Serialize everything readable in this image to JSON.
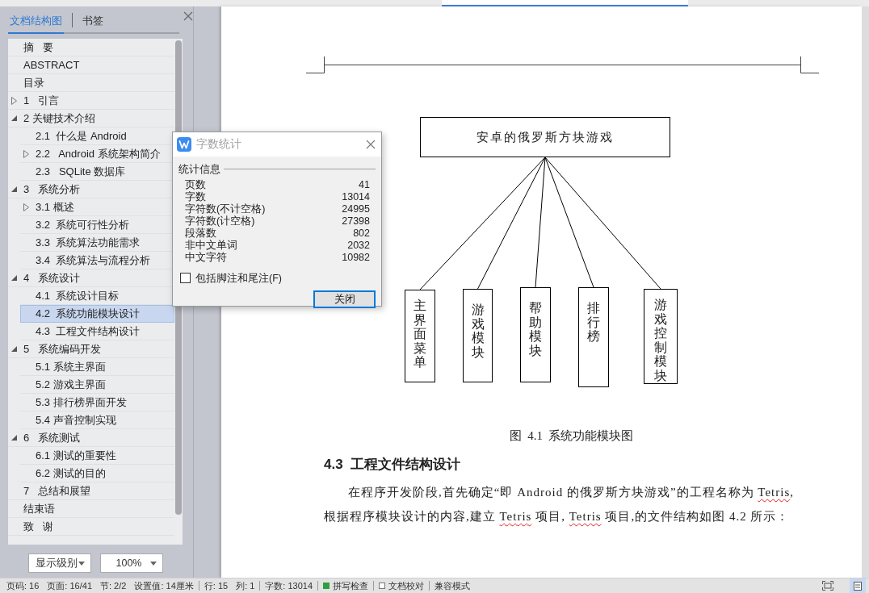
{
  "sidebar": {
    "tabs": [
      {
        "label": "文档结构图",
        "selected": true
      },
      {
        "label": "书签",
        "selected": false
      }
    ],
    "tree": [
      {
        "label": "摘   要",
        "kind": "entry",
        "selected": false
      },
      {
        "label": "ABSTRACT",
        "kind": "entry",
        "selected": false
      },
      {
        "label": "目录",
        "kind": "entry",
        "selected": false
      },
      {
        "label": "1   引言",
        "kind": "section",
        "expanded": false,
        "selected": false
      },
      {
        "label": "2 关键技术介绍",
        "kind": "section",
        "expanded": true,
        "selected": false,
        "children": [
          {
            "label": "2.1  什么是 Android",
            "kind": "entry",
            "selected": false
          },
          {
            "label": "2.2   Android 系统架构简介",
            "kind": "section",
            "expanded": false,
            "selected": false
          },
          {
            "label": "2.3   SQLite 数据库",
            "kind": "entry",
            "selected": false
          }
        ]
      },
      {
        "label": "3   系统分析",
        "kind": "section",
        "expanded": true,
        "selected": false,
        "children": [
          {
            "label": "3.1 概述",
            "kind": "section",
            "expanded": false,
            "selected": false
          },
          {
            "label": "3.2  系统可行性分析",
            "kind": "entry",
            "selected": false
          },
          {
            "label": "3.3  系统算法功能需求",
            "kind": "entry",
            "selected": false
          },
          {
            "label": "3.4  系统算法与流程分析",
            "kind": "entry",
            "selected": false
          }
        ]
      },
      {
        "label": "4   系统设计",
        "kind": "section",
        "expanded": true,
        "selected": false,
        "children": [
          {
            "label": "4.1  系统设计目标",
            "kind": "entry",
            "selected": false
          },
          {
            "label": "4.2  系统功能模块设计",
            "kind": "entry",
            "selected": true
          },
          {
            "label": "4.3  工程文件结构设计",
            "kind": "entry",
            "selected": false
          }
        ]
      },
      {
        "label": "5   系统编码开发",
        "kind": "section",
        "expanded": true,
        "selected": false,
        "children": [
          {
            "label": "5.1 系统主界面",
            "kind": "entry",
            "selected": false
          },
          {
            "label": "5.2 游戏主界面",
            "kind": "entry",
            "selected": false
          },
          {
            "label": "5.3 排行榜界面开发",
            "kind": "entry",
            "selected": false
          },
          {
            "label": "5.4 声音控制实现",
            "kind": "entry",
            "selected": false
          }
        ]
      },
      {
        "label": "6   系统测试",
        "kind": "section",
        "expanded": true,
        "selected": false,
        "children": [
          {
            "label": "6.1 测试的重要性",
            "kind": "entry",
            "selected": false
          },
          {
            "label": "6.2 测试的目的",
            "kind": "entry",
            "selected": false
          }
        ]
      },
      {
        "label": "7   总结和展望",
        "kind": "entry",
        "selected": false
      },
      {
        "label": "结束语",
        "kind": "entry",
        "selected": false
      },
      {
        "label": "致   谢",
        "kind": "entry",
        "selected": false
      }
    ],
    "level_dropdown": "显示级别",
    "zoom_dropdown": "100%"
  },
  "document": {
    "diagram": {
      "root": "安卓的俄罗斯方块游戏",
      "modules": [
        "主界面菜单",
        "游戏模块",
        "帮助模块",
        "排行榜",
        "游戏控制模块"
      ]
    },
    "caption": "图  4.1  系统功能模块图",
    "heading": "4.3  工程文件结构设计",
    "paragraph": [
      {
        "text": "在程序开发阶段,首先确定“即 Android 的俄罗斯方块游戏”的工程名称为 ",
        "misspelled": false
      },
      {
        "text": "Tetris",
        "misspelled": true
      },
      {
        "text": ",根据程序模块设计的内容,建立 ",
        "misspelled": false
      },
      {
        "text": "Tetris",
        "misspelled": true
      },
      {
        "text": " 项目, ",
        "misspelled": false
      },
      {
        "text": "Tetris",
        "misspelled": true
      },
      {
        "text": " 项目,的文件结构如图 4.2 所示：",
        "misspelled": false
      }
    ]
  },
  "dialog": {
    "title": "字数统计",
    "group_label": "统计信息",
    "stats": [
      {
        "label": "页数",
        "value": "41"
      },
      {
        "label": "字数",
        "value": "13014"
      },
      {
        "label": "字符数(不计空格)",
        "value": "24995"
      },
      {
        "label": "字符数(计空格)",
        "value": "27398"
      },
      {
        "label": "段落数",
        "value": "802"
      },
      {
        "label": "非中文单词",
        "value": "2032"
      },
      {
        "label": "中文字符",
        "value": "10982"
      }
    ],
    "include_notes": {
      "label": "包括脚注和尾注(F)",
      "checked": false
    },
    "close_button": "关闭"
  },
  "status_bar": {
    "sections": [
      {
        "items": [
          {
            "kind": "text",
            "text": "页码: 16"
          },
          {
            "kind": "text",
            "text": "页面: 16/41"
          },
          {
            "kind": "text",
            "text": "节: 2/2"
          },
          {
            "kind": "text",
            "text": "设置值: 14厘米"
          }
        ]
      },
      {
        "items": [
          {
            "kind": "text",
            "text": "行: 15"
          },
          {
            "kind": "text",
            "text": "列: 1"
          }
        ]
      },
      {
        "items": [
          {
            "kind": "text",
            "text": "字数: 13014"
          }
        ]
      },
      {
        "items": [
          {
            "kind": "toggle",
            "text": "拼写检查",
            "checked": true
          }
        ]
      },
      {
        "items": [
          {
            "kind": "toggle",
            "text": "文档校对",
            "checked": false
          }
        ]
      },
      {
        "items": [
          {
            "kind": "text",
            "text": "兼容模式"
          }
        ]
      }
    ]
  }
}
